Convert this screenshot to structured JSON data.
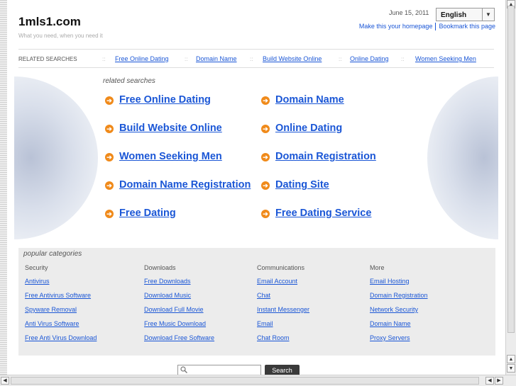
{
  "header": {
    "site_title": "1mls1.com",
    "tagline": "What you need, when you need it",
    "date": "June 15, 2011",
    "language": "English",
    "homepage_link": "Make this your homepage",
    "bookmark_link": "Bookmark this page"
  },
  "related_bar": {
    "label": "RELATED SEARCHES",
    "separator": "::",
    "links": [
      "Free Online Dating",
      "Domain Name",
      "Build Website Online",
      "Online Dating",
      "Women Seeking Men"
    ]
  },
  "related": {
    "heading": "related searches",
    "arrow_glyph": "➔",
    "items": [
      "Free Online Dating",
      "Domain Name",
      "Build Website Online",
      "Online Dating",
      "Women Seeking Men",
      "Domain Registration",
      "Domain Name Registration",
      "Dating Site",
      "Free Dating",
      "Free Dating Service"
    ]
  },
  "popular": {
    "heading": "popular categories",
    "columns": [
      {
        "title": "Security",
        "links": [
          "Antivirus",
          "Free Antivirus Software",
          "Spyware Removal",
          "Anti Virus Software",
          "Free Anti Virus Download"
        ]
      },
      {
        "title": "Downloads",
        "links": [
          "Free Downloads",
          "Download Music",
          "Download Full Movie",
          "Free Music Download",
          "Download Free Software"
        ]
      },
      {
        "title": "Communications",
        "links": [
          "Email Account",
          "Chat",
          "Instant Messenger",
          "Email",
          "Chat Room"
        ]
      },
      {
        "title": "More",
        "links": [
          "Email Hosting",
          "Domain Registration",
          "Network Security",
          "Domain Name",
          "Proxy Servers"
        ]
      }
    ]
  },
  "search": {
    "value": "",
    "button_label": "Search"
  },
  "icons": {
    "arrow_up": "▲",
    "arrow_down": "▼",
    "arrow_left": "◀",
    "arrow_right": "▶",
    "dropdown": "▼"
  },
  "colors": {
    "link": "#1a56d6",
    "arrow_icon": "#f08a1a",
    "popular_bg": "#ececec"
  }
}
